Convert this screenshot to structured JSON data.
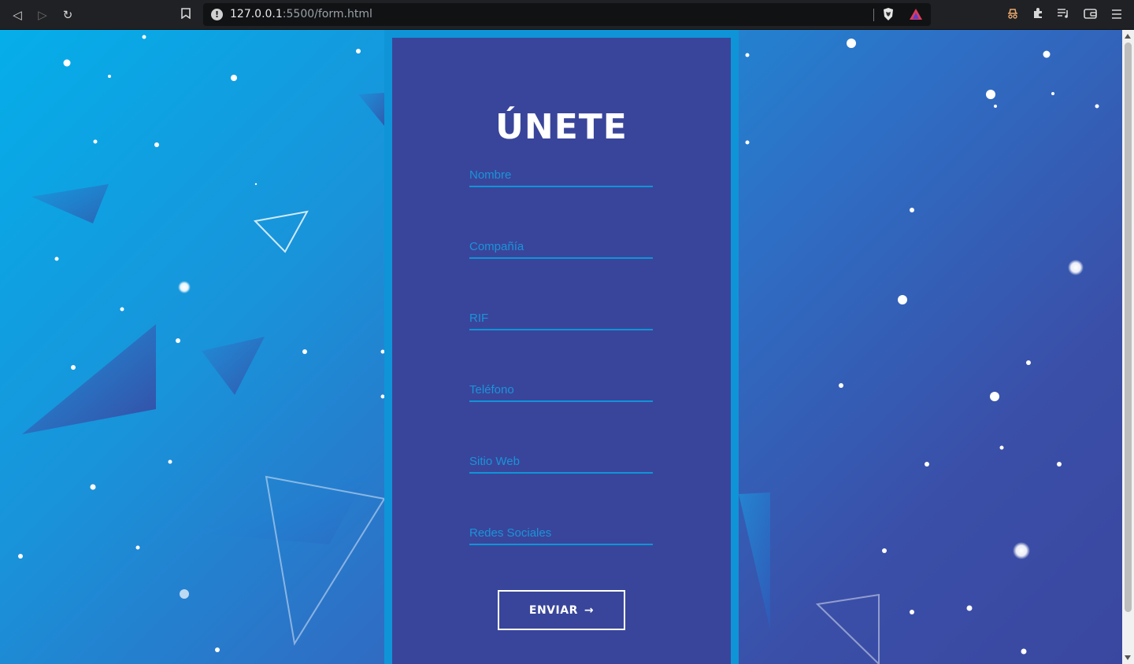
{
  "browser": {
    "url_host": "127.0.0.1",
    "url_path": ":5500/form.html",
    "back_icon": "back-icon",
    "forward_icon": "forward-icon",
    "reload_icon": "reload-icon",
    "bookmark_icon": "bookmark-icon",
    "info_icon": "info-icon",
    "shield_icon": "brave-shield-icon",
    "rewards_icon": "brave-rewards-icon",
    "toolbar_icons": [
      "incognito-icon",
      "extensions-icon",
      "playlist-icon",
      "wallet-icon",
      "menu-icon"
    ]
  },
  "form": {
    "title": "ÚNETE",
    "fields": [
      {
        "name": "nombre",
        "placeholder": "Nombre",
        "value": ""
      },
      {
        "name": "compania",
        "placeholder": "Compañía",
        "value": ""
      },
      {
        "name": "rif",
        "placeholder": "RIF",
        "value": ""
      },
      {
        "name": "telefono",
        "placeholder": "Teléfono",
        "value": ""
      },
      {
        "name": "sitio-web",
        "placeholder": "Sitio Web",
        "value": ""
      },
      {
        "name": "redes-sociales",
        "placeholder": "Redes Sociales",
        "value": ""
      }
    ],
    "submit_label": "ENVIAR",
    "submit_icon": "→"
  },
  "colors": {
    "card_bg": "#39459a",
    "frame": "#0f94d8",
    "accent": "#1a93da",
    "bg_start": "#05aee9",
    "bg_end": "#3a47a0"
  }
}
